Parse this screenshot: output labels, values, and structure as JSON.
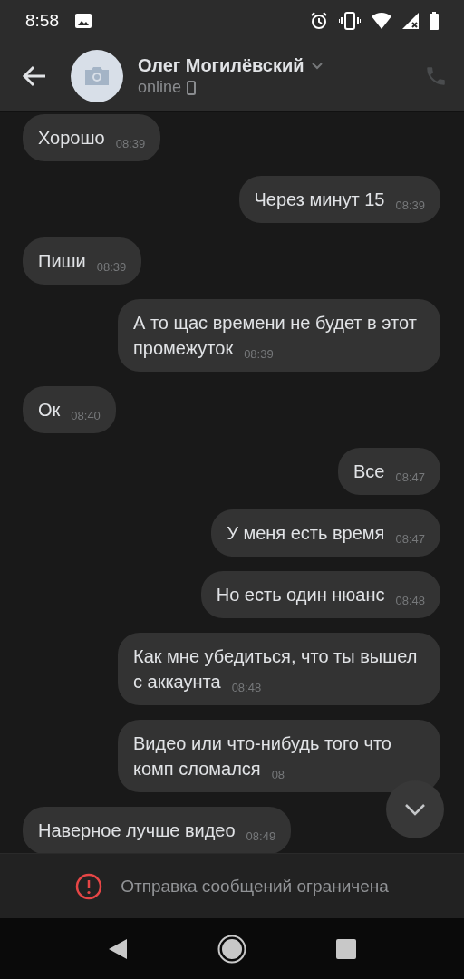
{
  "status_bar": {
    "time": "8:58"
  },
  "header": {
    "title": "Олег Могилёвский",
    "status": "online"
  },
  "messages": [
    {
      "kind": "incoming",
      "text": "Хорошо",
      "time": "08:39"
    },
    {
      "kind": "outgoing",
      "text": "Через минут 15",
      "time": "08:39"
    },
    {
      "kind": "incoming",
      "text": "Пиши",
      "time": "08:39"
    },
    {
      "kind": "outgoing",
      "text": "А то щас времени не будет в этот промежуток",
      "time": "08:39"
    },
    {
      "kind": "incoming",
      "text": "Ок",
      "time": "08:40"
    },
    {
      "kind": "outgoing",
      "text": "Все",
      "time": "08:47"
    },
    {
      "kind": "outgoing",
      "text": "У меня есть время",
      "time": "08:47"
    },
    {
      "kind": "outgoing",
      "text": "Но есть один нюанс",
      "time": "08:48"
    },
    {
      "kind": "outgoing",
      "text": "Как мне убедиться, что ты вышел с аккаунта",
      "time": "08:48"
    },
    {
      "kind": "outgoing",
      "text": "Видео или что-нибудь того что комп сломался",
      "time": "08"
    },
    {
      "kind": "incoming",
      "text": "Наверное лучше видео",
      "time": "08:49"
    }
  ],
  "notice": {
    "text": "Отправка сообщений ограничена"
  }
}
